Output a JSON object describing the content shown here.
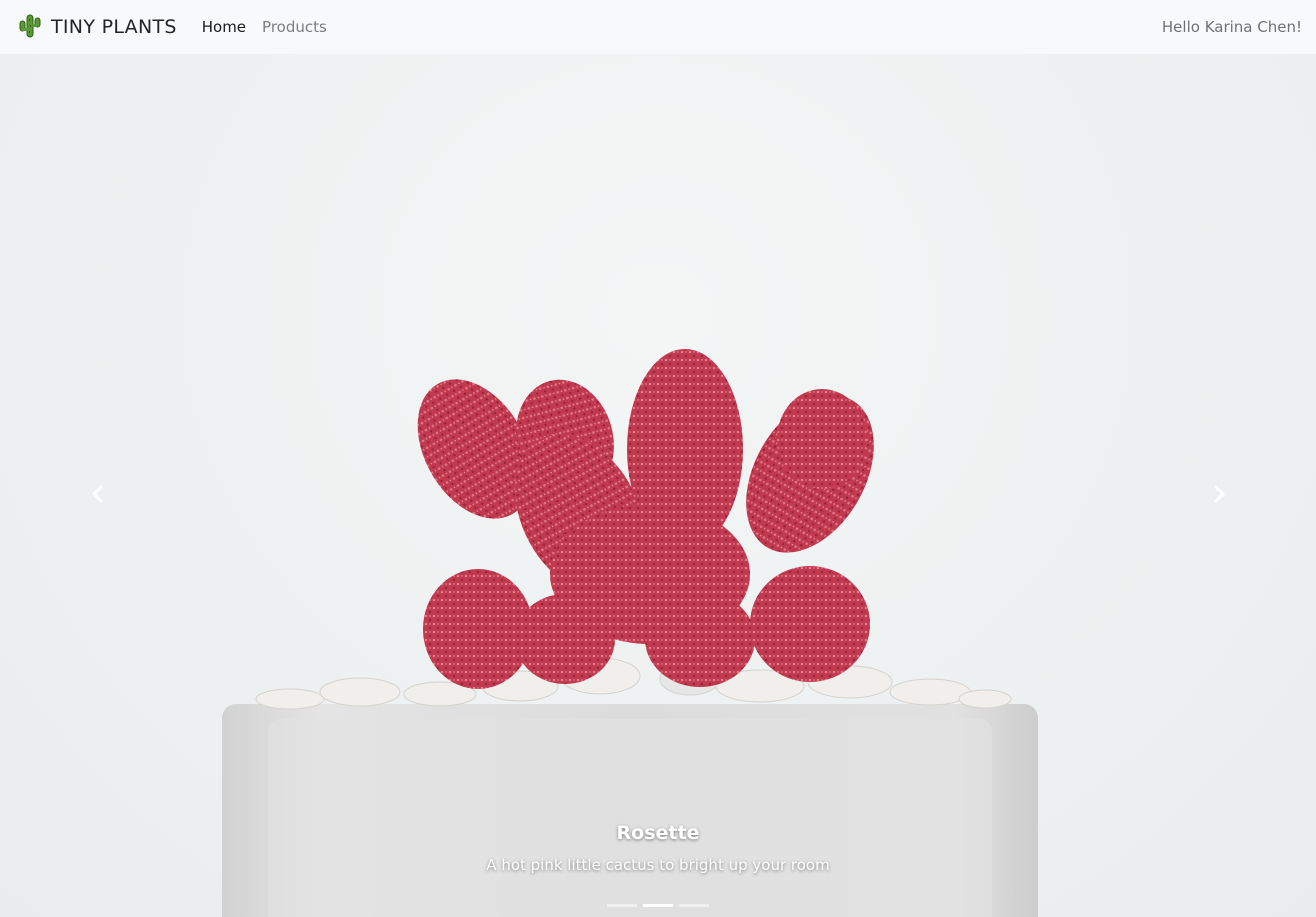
{
  "brand": {
    "name": "TINY PLANTS",
    "icon": "cactus-icon"
  },
  "nav": {
    "items": [
      {
        "label": "Home",
        "active": true
      },
      {
        "label": "Products",
        "active": false
      }
    ]
  },
  "user": {
    "greeting": "Hello Karina Chen!"
  },
  "carousel": {
    "slides": [
      {
        "title": "Rosette",
        "text": "A hot pink little cactus to bright up your room"
      }
    ],
    "active_index": 1,
    "indicator_count": 3,
    "prev_icon": "chevron-left-icon",
    "next_icon": "chevron-right-icon"
  },
  "colors": {
    "cactus": "#c0394f",
    "pot": "#dcdcdc",
    "navbar_bg": "#f8f9fa"
  }
}
